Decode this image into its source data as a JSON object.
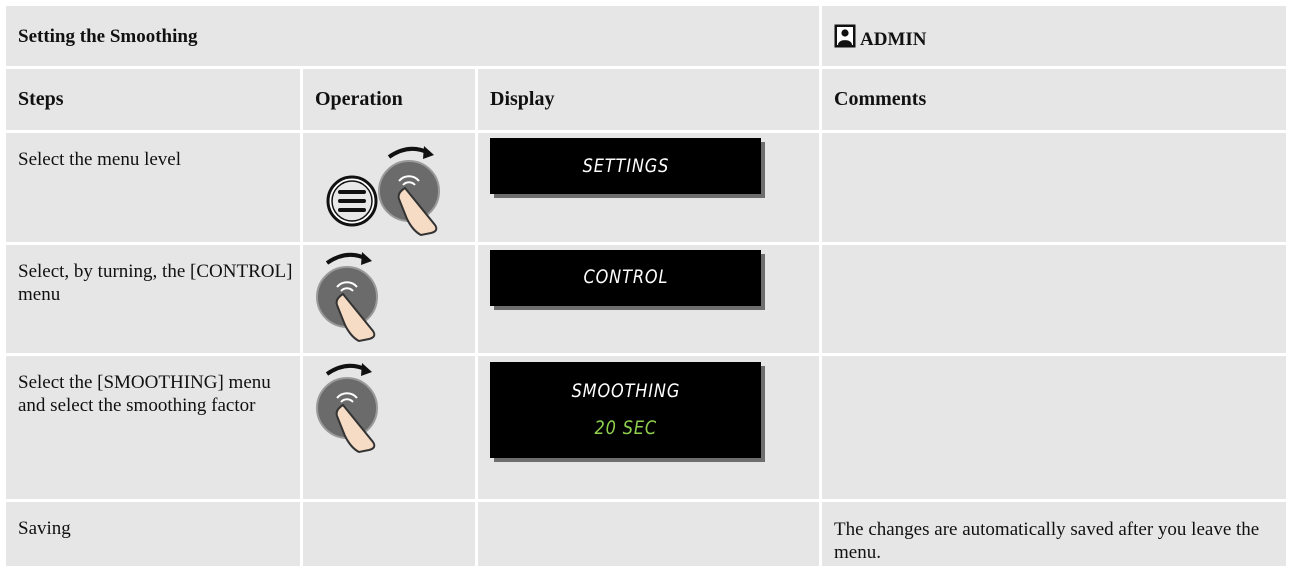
{
  "title": "Setting the Smoothing",
  "role": {
    "label": "ADMIN",
    "icon": "user-icon"
  },
  "headers": {
    "steps": "Steps",
    "operation": "Operation",
    "display": "Display",
    "comments": "Comments"
  },
  "rows": [
    {
      "step": "Select the menu level",
      "operation": [
        "menu-button-icon",
        "turn-knob-icon"
      ],
      "display": {
        "line1": "SETTINGS",
        "line2": ""
      },
      "comment": ""
    },
    {
      "step": "Select, by turning, the [CONTROL] menu",
      "operation": [
        "turn-knob-icon"
      ],
      "display": {
        "line1": "CONTROL",
        "line2": ""
      },
      "comment": ""
    },
    {
      "step": "Select the [SMOOTHING] menu and select the smoothing factor",
      "operation": [
        "turn-knob-icon"
      ],
      "display": {
        "line1": "SMOOTHING",
        "line2": "20 SEC"
      },
      "comment": ""
    },
    {
      "step": "Saving",
      "operation": [],
      "display": null,
      "comment": "The changes are automatically saved after you leave the menu."
    }
  ],
  "colors": {
    "cell_bg": "#e6e6e6",
    "lcd_bg": "#000000",
    "lcd_text": "#ffffff",
    "lcd_value": "#8fd14f"
  }
}
